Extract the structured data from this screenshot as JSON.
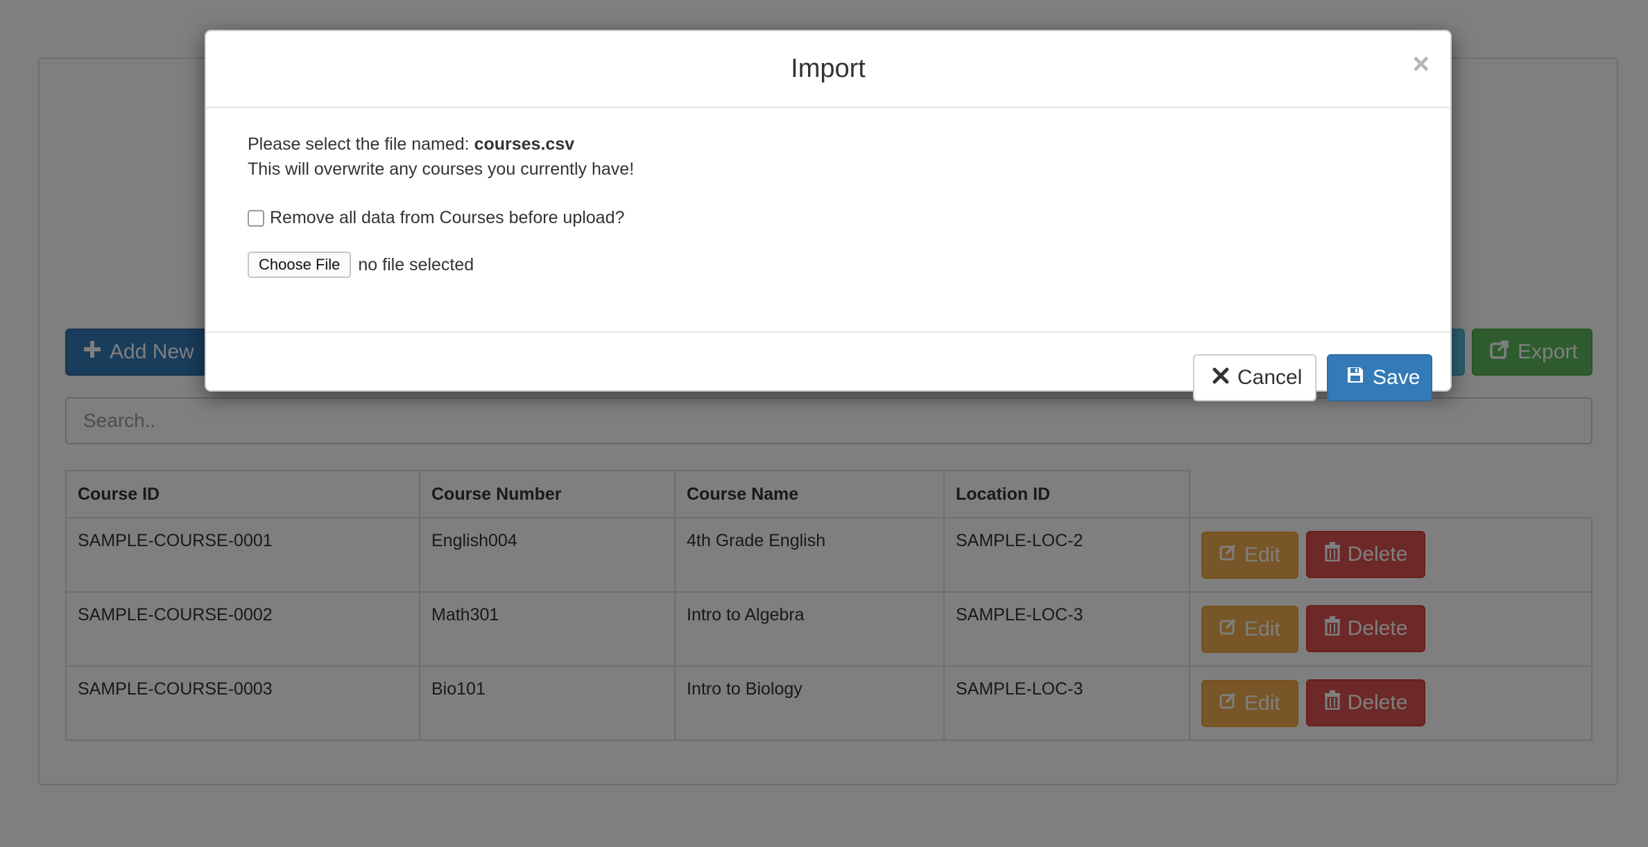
{
  "toolbar": {
    "add_new_label": "Add New",
    "import_label": "",
    "export_label": "Export"
  },
  "search": {
    "placeholder": "Search.."
  },
  "table": {
    "headers": [
      "Course ID",
      "Course Number",
      "Course Name",
      "Location ID"
    ],
    "rows": [
      [
        "SAMPLE-COURSE-0001",
        "English004",
        "4th Grade English",
        "SAMPLE-LOC-2"
      ],
      [
        "SAMPLE-COURSE-0002",
        "Math301",
        "Intro to Algebra",
        "SAMPLE-LOC-3"
      ],
      [
        "SAMPLE-COURSE-0003",
        "Bio101",
        "Intro to Biology",
        "SAMPLE-LOC-3"
      ]
    ],
    "edit_label": "Edit",
    "delete_label": "Delete"
  },
  "modal": {
    "title": "Import",
    "close_glyph": "×",
    "line1_prefix": "Please select the file named: ",
    "filename": "courses.csv",
    "line2": "This will overwrite any courses you currently have!",
    "remove_label": "Remove all data from Courses before upload?",
    "choose_file_label": "Choose File",
    "no_file_label": "no file selected",
    "cancel_label": "Cancel",
    "save_label": "Save"
  },
  "colors": {
    "primary": "#337ab7",
    "success": "#5cb85c",
    "info": "#5bc0de",
    "warning": "#f0ad4e",
    "danger": "#d9534f"
  },
  "icons": {
    "add": "plus-icon",
    "export": "export-icon",
    "edit": "edit-icon",
    "delete": "trash-icon",
    "cancel": "x-icon",
    "save": "floppy-icon"
  }
}
